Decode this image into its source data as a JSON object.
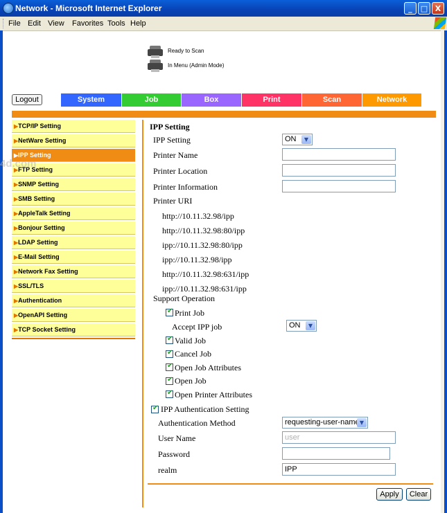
{
  "window": {
    "title": "Network - Microsoft Internet Explorer",
    "controls": {
      "minimize": "_",
      "maximize": "□",
      "close": "X"
    }
  },
  "menu": [
    "File",
    "Edit",
    "View",
    "Favorites",
    "Tools",
    "Help"
  ],
  "status": {
    "line1": "Ready to Scan",
    "line2": "In Menu (Admin Mode)"
  },
  "watermark": "4d.com",
  "header": {
    "logout": "Logout",
    "tabs": [
      {
        "label": "System",
        "color": "#3366ff"
      },
      {
        "label": "Job",
        "color": "#33cc33"
      },
      {
        "label": "Box",
        "color": "#9966ff"
      },
      {
        "label": "Print",
        "color": "#ff3366"
      },
      {
        "label": "Scan",
        "color": "#ff6633"
      },
      {
        "label": "Network",
        "color": "#ff9900"
      }
    ]
  },
  "sidebar": {
    "active_index": 2,
    "items": [
      {
        "label": "TCP/IP Setting"
      },
      {
        "label": "NetWare Setting"
      },
      {
        "label": "IPP Setting"
      },
      {
        "label": "FTP Setting"
      },
      {
        "label": "SNMP Setting"
      },
      {
        "label": "SMB Setting"
      },
      {
        "label": "AppleTalk Setting"
      },
      {
        "label": "Bonjour Setting"
      },
      {
        "label": "LDAP Setting"
      },
      {
        "label": "E-Mail Setting"
      },
      {
        "label": "Network Fax Setting"
      },
      {
        "label": "SSL/TLS"
      },
      {
        "label": "Authentication"
      },
      {
        "label": "OpenAPI Setting"
      },
      {
        "label": "TCP Socket Setting"
      }
    ]
  },
  "ipp": {
    "title": "IPP Setting",
    "ipp_setting_label": "IPP Setting",
    "ipp_setting_value": "ON",
    "printer_name_label": "Printer Name",
    "printer_name_value": "",
    "printer_location_label": "Printer Location",
    "printer_location_value": "",
    "printer_information_label": "Printer Information",
    "printer_information_value": "",
    "printer_uri_label": "Printer URI",
    "uris": [
      "http://10.11.32.98/ipp",
      "http://10.11.32.98:80/ipp",
      "ipp://10.11.32.98:80/ipp",
      "ipp://10.11.32.98/ipp",
      "http://10.11.32.98:631/ipp",
      "ipp://10.11.32.98:631/ipp"
    ],
    "support_operation_label": "Support Operation",
    "print_job_label": "Print Job",
    "print_job_checked": true,
    "accept_ipp_job_label": "Accept IPP job",
    "accept_ipp_job_value": "ON",
    "operations": [
      {
        "label": "Valid Job",
        "checked": true
      },
      {
        "label": "Cancel Job",
        "checked": true
      },
      {
        "label": "Open Job Attributes",
        "checked": true
      },
      {
        "label": "Open Job",
        "checked": true
      },
      {
        "label": "Open Printer Attributes",
        "checked": true
      }
    ],
    "auth_setting_label": "IPP Authentication Setting",
    "auth_setting_checked": true,
    "auth_method_label": "Authentication Method",
    "auth_method_value": "requesting-user-name",
    "user_name_label": "User Name",
    "user_name_placeholder": "user",
    "password_label": "Password",
    "password_value": "",
    "realm_label": "realm",
    "realm_value": "IPP"
  },
  "buttons": {
    "apply": "Apply",
    "clear": "Clear"
  }
}
